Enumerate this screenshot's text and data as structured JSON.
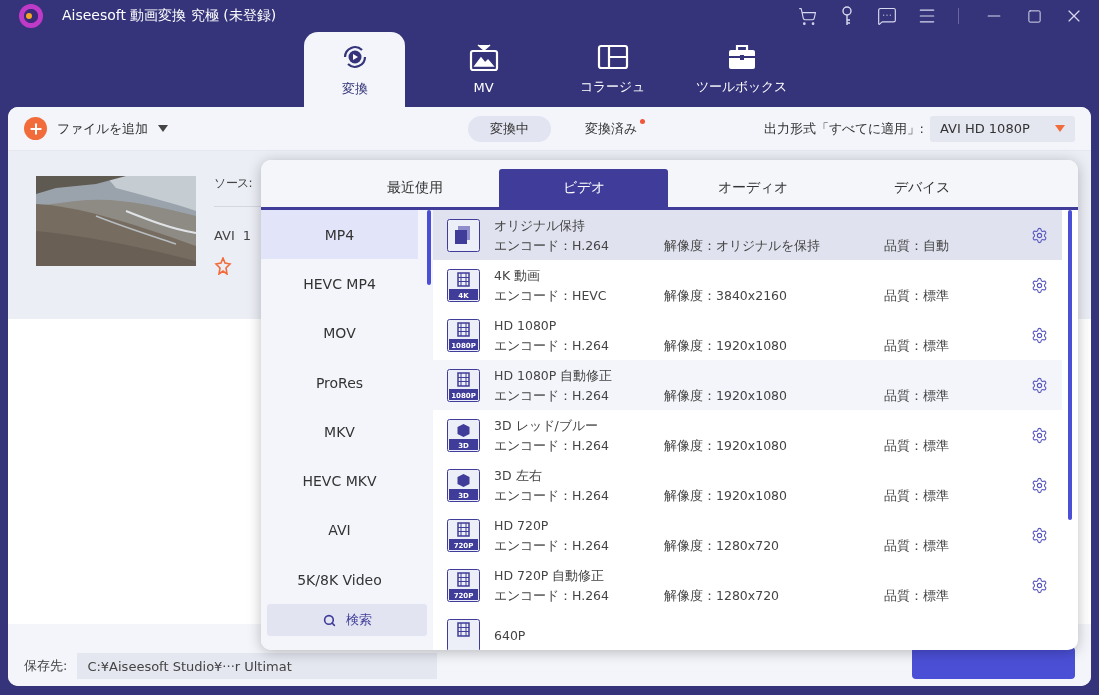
{
  "window": {
    "title": "Aiseesoft 動画変換 究極 (未登録)"
  },
  "nav_tabs": [
    {
      "label": "変換",
      "kind": "convert",
      "selected": true
    },
    {
      "label": "MV",
      "kind": "tv",
      "selected": false
    },
    {
      "label": "コラージュ",
      "kind": "collage",
      "selected": false
    },
    {
      "label": "ツールボックス",
      "kind": "toolbox",
      "selected": false
    }
  ],
  "toolbar": {
    "add_file": "ファイルを追加",
    "status_tabs": [
      {
        "label": "変換中",
        "selected": true,
        "notify": false
      },
      {
        "label": "変換済み",
        "selected": false,
        "notify": true
      }
    ],
    "output_label": "出力形式「すべてに適用」:",
    "output_value": "AVI HD 1080P"
  },
  "file": {
    "source_label": "ソース:",
    "format": "AVI",
    "column_2": "1"
  },
  "bottom_bar": {
    "save_label": "保存先:",
    "save_path": "C:¥Aiseesoft Studio¥···r Ultimat"
  },
  "format_popup": {
    "tabs": [
      {
        "label": "最近使用",
        "selected": false
      },
      {
        "label": "ビデオ",
        "selected": true
      },
      {
        "label": "オーディオ",
        "selected": false
      },
      {
        "label": "デバイス",
        "selected": false
      }
    ],
    "formats": [
      {
        "label": "MP4",
        "selected": true
      },
      {
        "label": "HEVC MP4",
        "selected": false
      },
      {
        "label": "MOV",
        "selected": false
      },
      {
        "label": "ProRes",
        "selected": false
      },
      {
        "label": "MKV",
        "selected": false
      },
      {
        "label": "HEVC MKV",
        "selected": false
      },
      {
        "label": "AVI",
        "selected": false
      },
      {
        "label": "5K/8K Video",
        "selected": false
      }
    ],
    "search": "検索",
    "presets": [
      {
        "kind": "copy",
        "name": "オリジナル保持",
        "encode": "エンコード：H.264",
        "resolution": "解像度：オリジナルを保持",
        "quality": "品質：自動",
        "selected": true,
        "hovered": false
      },
      {
        "kind": "film",
        "badge": "4K",
        "name": "4K 動画",
        "encode": "エンコード：HEVC",
        "resolution": "解像度：3840x2160",
        "quality": "品質：標準",
        "selected": false,
        "hovered": false
      },
      {
        "kind": "film",
        "badge": "1080P",
        "name": "HD 1080P",
        "encode": "エンコード：H.264",
        "resolution": "解像度：1920x1080",
        "quality": "品質：標準",
        "selected": false,
        "hovered": false
      },
      {
        "kind": "film",
        "badge": "1080P",
        "name": "HD 1080P 自動修正",
        "encode": "エンコード：H.264",
        "resolution": "解像度：1920x1080",
        "quality": "品質：標準",
        "selected": false,
        "hovered": true
      },
      {
        "kind": "cube",
        "badge": "3D",
        "name": "3D レッド/ブルー",
        "encode": "エンコード：H.264",
        "resolution": "解像度：1920x1080",
        "quality": "品質：標準",
        "selected": false,
        "hovered": false
      },
      {
        "kind": "cube",
        "badge": "3D",
        "name": "3D 左右",
        "encode": "エンコード：H.264",
        "resolution": "解像度：1920x1080",
        "quality": "品質：標準",
        "selected": false,
        "hovered": false
      },
      {
        "kind": "film",
        "badge": "720P",
        "name": "HD 720P",
        "encode": "エンコード：H.264",
        "resolution": "解像度：1280x720",
        "quality": "品質：標準",
        "selected": false,
        "hovered": false
      },
      {
        "kind": "film",
        "badge": "720P",
        "name": "HD 720P 自動修正",
        "encode": "エンコード：H.264",
        "resolution": "解像度：1280x720",
        "quality": "品質：標準",
        "selected": false,
        "hovered": false
      },
      {
        "kind": "film",
        "name": "640P",
        "selected": false,
        "hovered": false
      }
    ]
  }
}
